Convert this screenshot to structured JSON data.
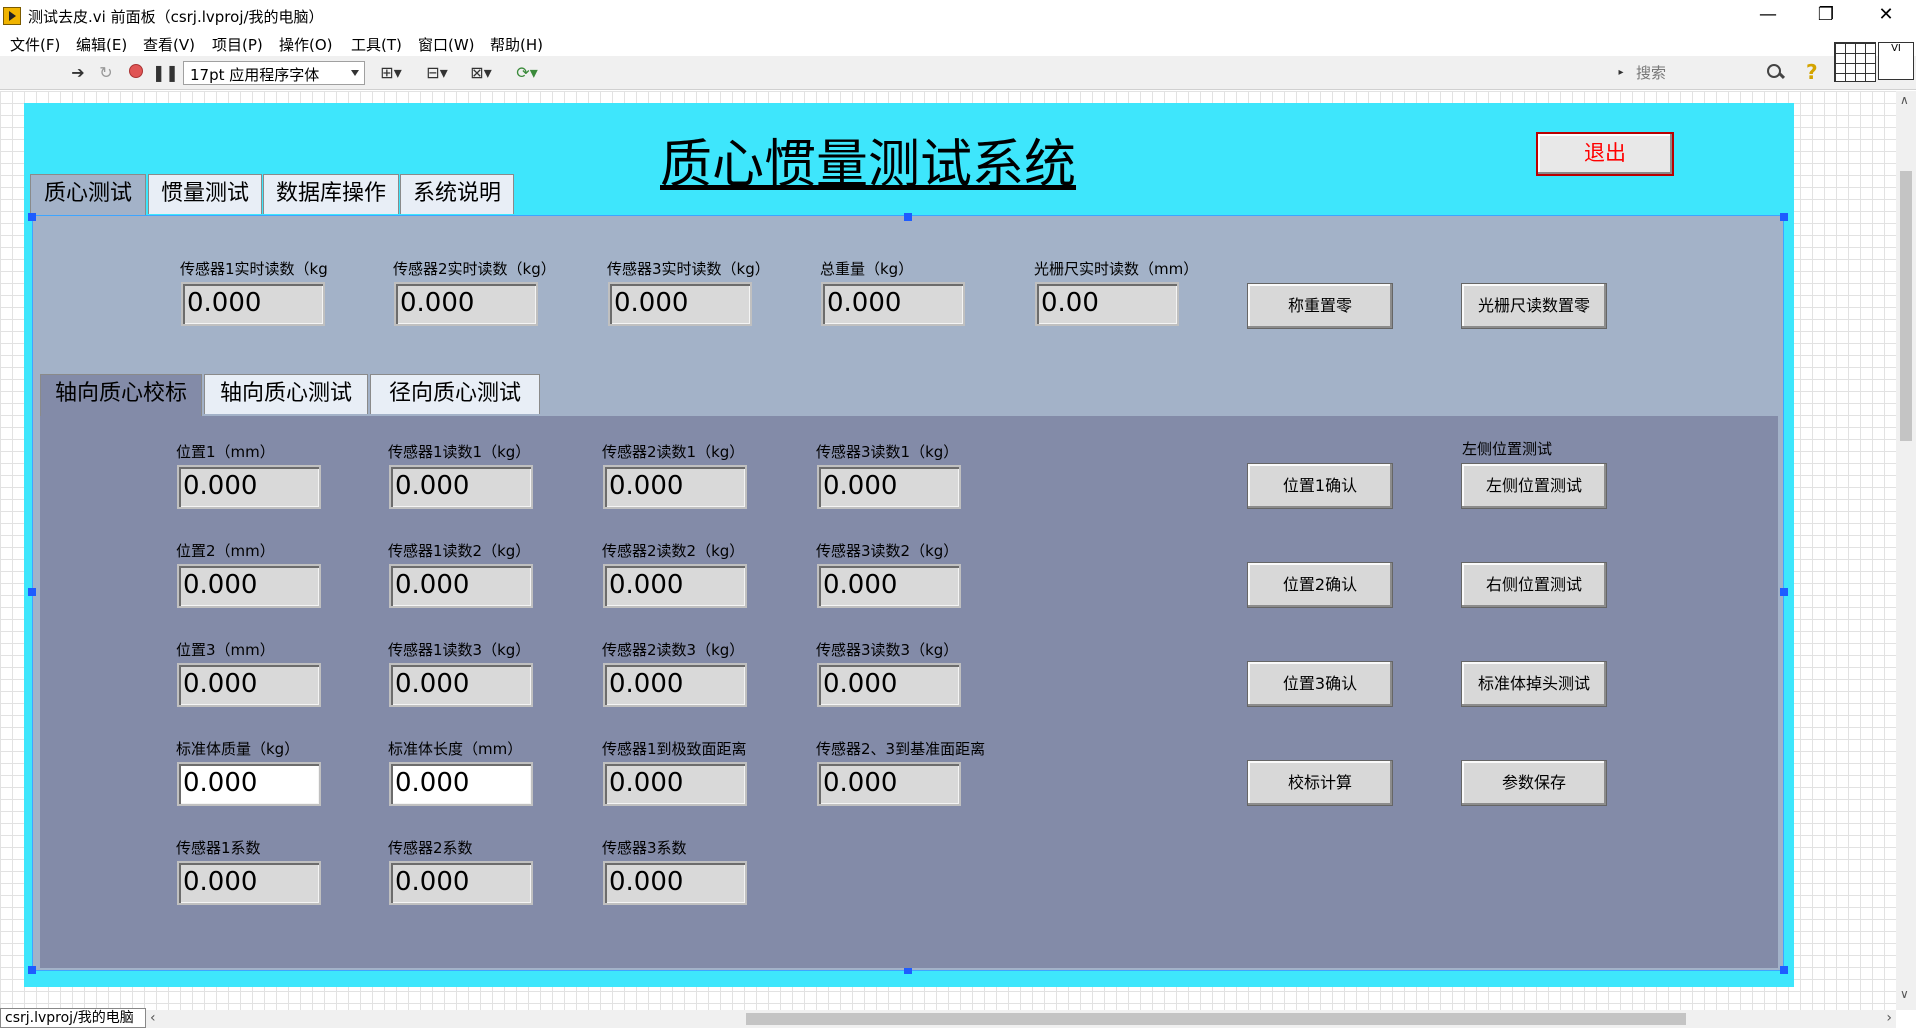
{
  "window": {
    "title": "测试去皮.vi 前面板（csrj.lvproj/我的电脑）",
    "minimize": "—",
    "maximize": "❐",
    "close": "✕"
  },
  "menu": [
    "文件(F)",
    "编辑(E)",
    "查看(V)",
    "项目(P)",
    "操作(O)",
    "工具(T)",
    "窗口(W)",
    "帮助(H)"
  ],
  "toolbar": {
    "font": "17pt 应用程序字体",
    "search_placeholder": "搜索",
    "vi_icon_text": "VI"
  },
  "front_panel": {
    "title": "质心惯量测试系统",
    "exit_button": "退出",
    "tabs": [
      "质心测试",
      "惯量测试",
      "数据库操作",
      "系统说明"
    ],
    "readings": [
      {
        "label": "传感器1实时读数（kg",
        "value": "0.000"
      },
      {
        "label": "传感器2实时读数（kg）",
        "value": "0.000"
      },
      {
        "label": "传感器3实时读数（kg）",
        "value": "0.000"
      },
      {
        "label": "总重量（kg）",
        "value": "0.000"
      },
      {
        "label": "光栅尺实时读数（mm）",
        "value": "0.00"
      }
    ],
    "zero_buttons": [
      "称重置零",
      "光栅尺读数置零"
    ],
    "inner_tabs": [
      "轴向质心校标",
      "轴向质心测试",
      "径向质心测试"
    ],
    "calibration": {
      "rows": [
        [
          {
            "label": "位置1（mm）",
            "value": "0.000"
          },
          {
            "label": "传感器1读数1（kg）",
            "value": "0.000"
          },
          {
            "label": "传感器2读数1（kg）",
            "value": "0.000"
          },
          {
            "label": "传感器3读数1（kg）",
            "value": "0.000"
          }
        ],
        [
          {
            "label": "位置2（mm）",
            "value": "0.000"
          },
          {
            "label": "传感器1读数2（kg）",
            "value": "0.000"
          },
          {
            "label": "传感器2读数2（kg）",
            "value": "0.000"
          },
          {
            "label": "传感器3读数2（kg）",
            "value": "0.000"
          }
        ],
        [
          {
            "label": "位置3（mm）",
            "value": "0.000"
          },
          {
            "label": "传感器1读数3（kg）",
            "value": "0.000"
          },
          {
            "label": "传感器2读数3（kg）",
            "value": "0.000"
          },
          {
            "label": "传感器3读数3（kg）",
            "value": "0.000"
          }
        ],
        [
          {
            "label": "标准体质量（kg）",
            "value": "0.000"
          },
          {
            "label": "标准体长度（mm）",
            "value": "0.000"
          },
          {
            "label": "传感器1到极致面距离",
            "value": "0.000"
          },
          {
            "label": "传感器2、3到基准面距离",
            "value": "0.000"
          }
        ],
        [
          {
            "label": "传感器1系数",
            "value": "0.000"
          },
          {
            "label": "传感器2系数",
            "value": "0.000"
          },
          {
            "label": "传感器3系数",
            "value": "0.000"
          }
        ]
      ],
      "left_buttons": [
        "位置1确认",
        "位置2确认",
        "位置3确认",
        "校标计算"
      ],
      "right_label": "左侧位置测试",
      "right_buttons": [
        "左侧位置测试",
        "右侧位置测试",
        "标准体掉头测试",
        "参数保存"
      ]
    }
  },
  "status": {
    "context": "csrj.lvproj/我的电脑"
  }
}
